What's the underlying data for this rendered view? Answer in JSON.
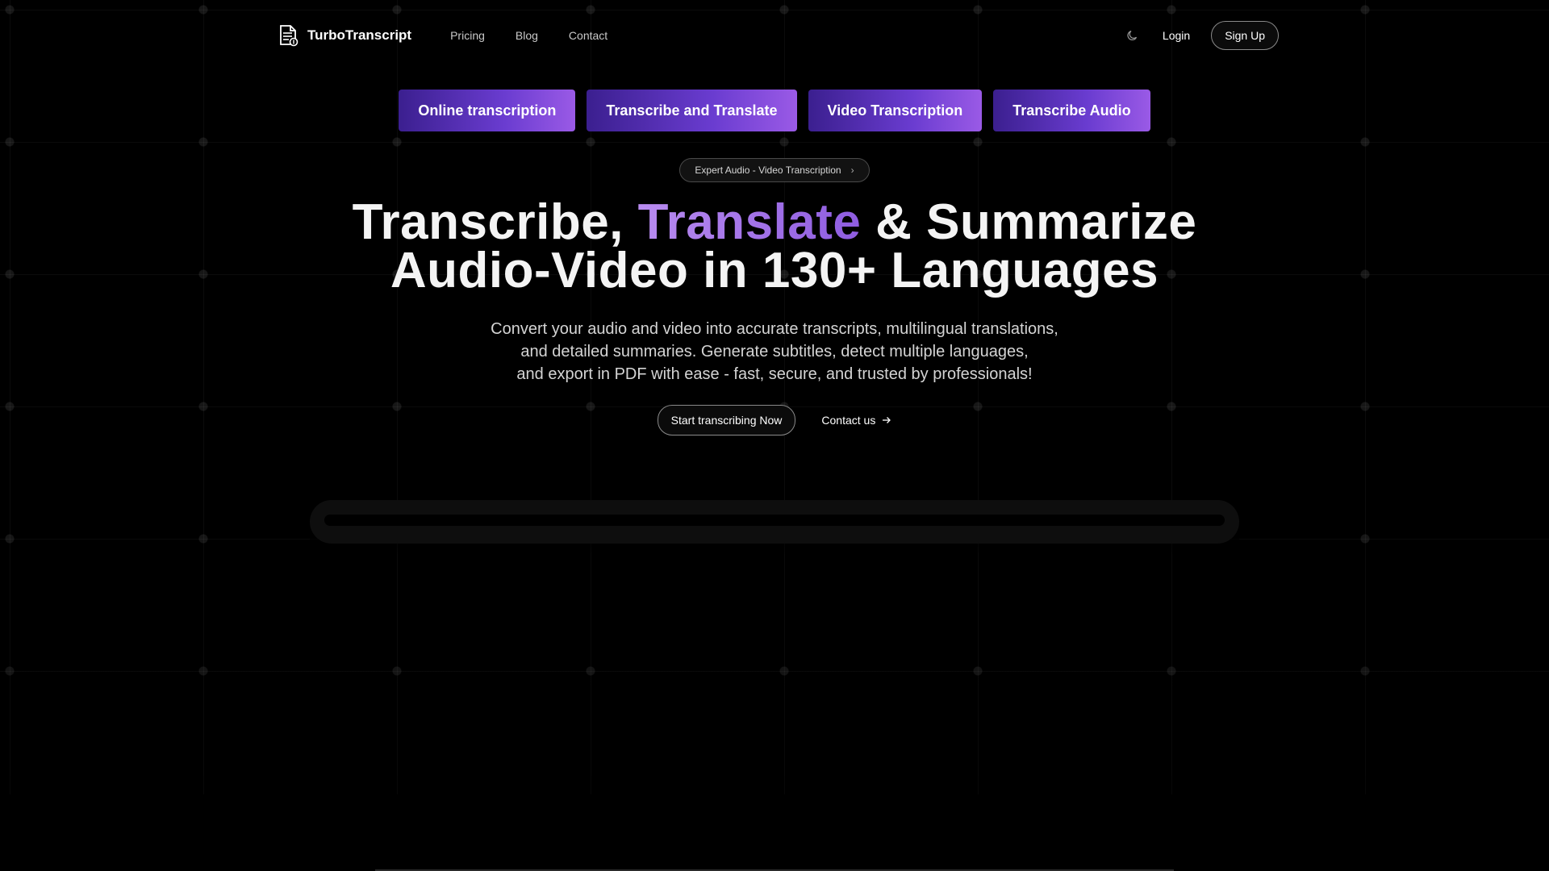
{
  "brand": {
    "name": "TurboTranscript",
    "logo_icon": "document-icon"
  },
  "nav": {
    "links": [
      {
        "label": "Pricing"
      },
      {
        "label": "Blog"
      },
      {
        "label": "Contact"
      }
    ],
    "theme_icon": "moon-icon",
    "login_label": "Login",
    "signup_label": "Sign Up"
  },
  "features": [
    {
      "label": "Online transcription"
    },
    {
      "label": "Transcribe and Translate"
    },
    {
      "label": "Video Transcription"
    },
    {
      "label": "Transcribe Audio"
    }
  ],
  "badge": {
    "label": "Expert Audio - Video Transcription",
    "icon": "chevron-right-icon"
  },
  "hero": {
    "line1_part1": "Transcribe, ",
    "line1_accent": "Translate",
    "line1_part2": " & Summarize",
    "line2": "Audio-Video in 130+ Languages",
    "sub_line1": "Convert your audio and video into accurate transcripts, multilingual translations,",
    "sub_line2": "and detailed summaries. Generate subtitles, detect multiple languages,",
    "sub_line3": "and export in PDF with ease - fast, secure, and trusted by professionals!"
  },
  "cta": {
    "primary_label": "Start transcribing Now",
    "secondary_label": "Contact us",
    "secondary_icon": "arrow-right-icon"
  },
  "colors": {
    "background": "#000000",
    "accent_start": "#3b1f8f",
    "accent_end": "#9a5ae6",
    "accent_text": "#b98cf0"
  }
}
